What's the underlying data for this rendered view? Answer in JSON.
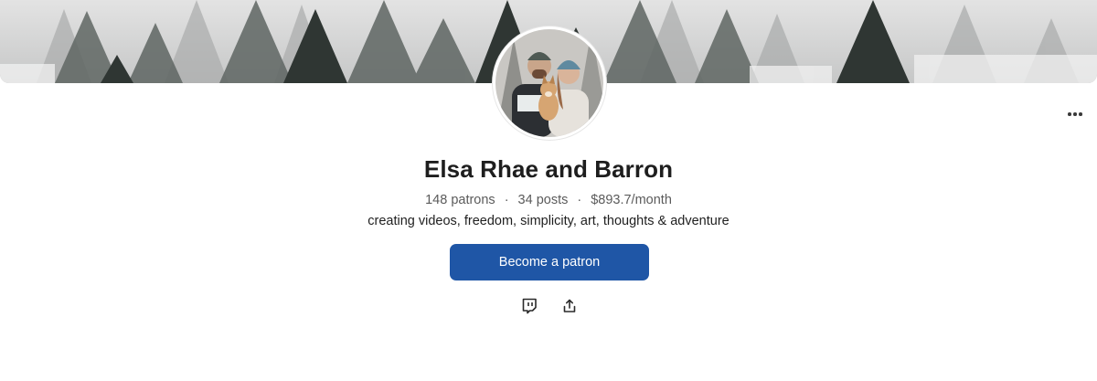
{
  "creator": {
    "name": "Elsa Rhae and Barron",
    "patrons": "148 patrons",
    "posts": "34 posts",
    "earnings": "$893.7/month",
    "tagline": "creating videos, freedom, simplicity, art, thoughts & adventure"
  },
  "actions": {
    "become_patron_label": "Become a patron"
  },
  "icons": {
    "more": "more-horizontal-icon",
    "twitch": "twitch-icon",
    "share": "share-icon"
  },
  "colors": {
    "primary": "#1f56a6",
    "text": "#1e1e1e",
    "muted": "#5b5b5b"
  }
}
